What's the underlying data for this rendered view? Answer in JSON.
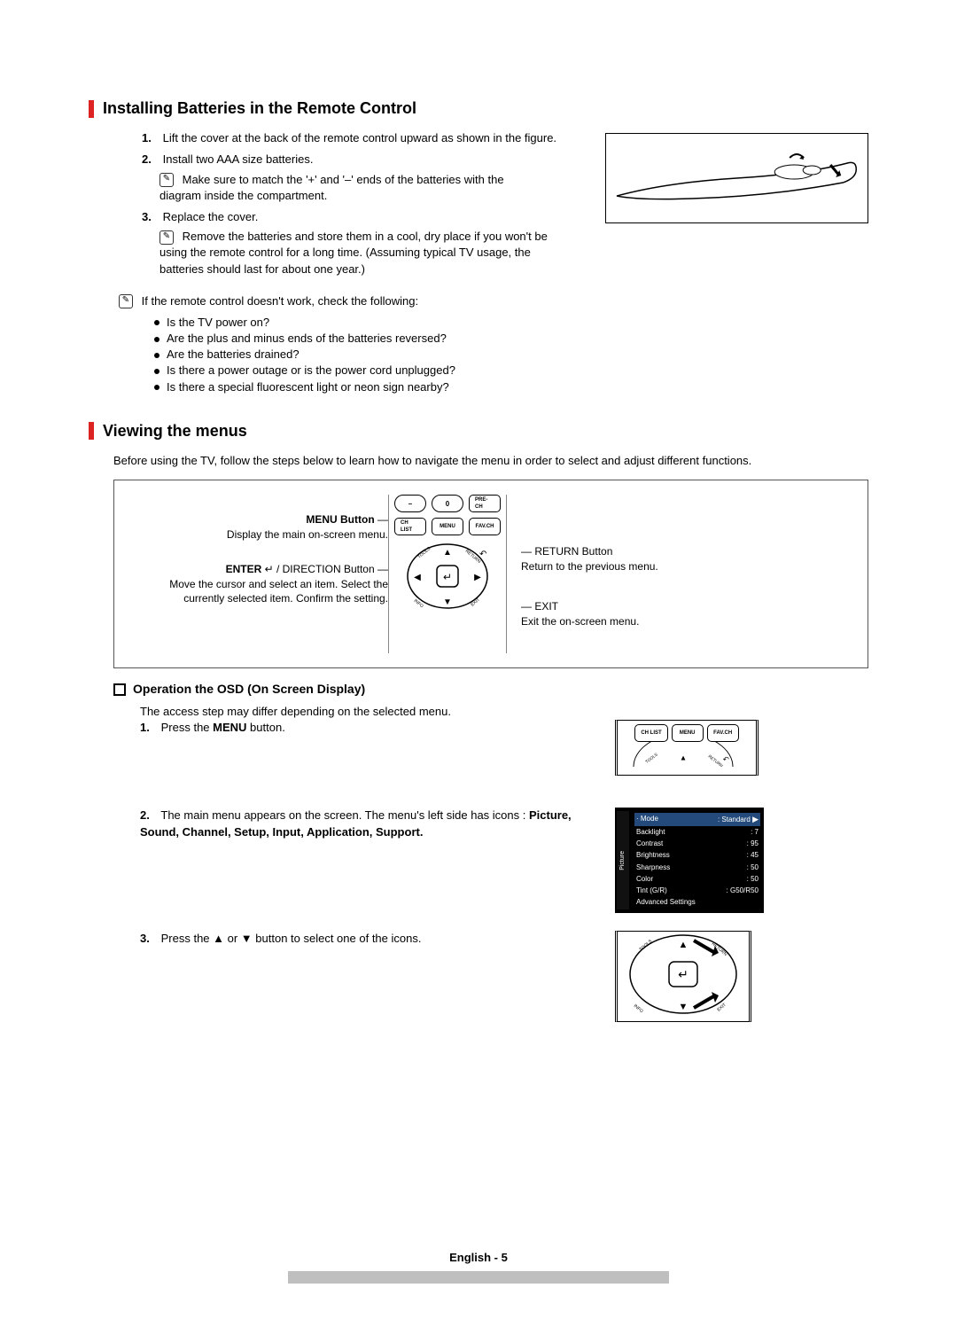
{
  "sections": {
    "batteries": {
      "title": "Installing Batteries in the Remote Control",
      "steps": [
        {
          "n": "1.",
          "text": "Lift the cover at the back of the remote control upward as shown in the figure."
        },
        {
          "n": "2.",
          "text": "Install two AAA size batteries.",
          "note": "Make sure to match the '+' and '–' ends of the batteries with the diagram inside the compartment."
        },
        {
          "n": "3.",
          "text": "Replace the cover.",
          "note": "Remove the batteries and store them in a cool, dry place if you won't be using the remote control for a long time. (Assuming typical TV usage, the batteries should last for about one year.)"
        }
      ],
      "check_intro": "If the remote control doesn't work, check the following:",
      "checks": [
        "Is the TV power on?",
        "Are the plus and minus ends of the batteries reversed?",
        "Are the batteries drained?",
        "Is there a power outage or is the power cord unplugged?",
        "Is there a special fluorescent light or neon sign nearby?"
      ]
    },
    "menus": {
      "title": "Viewing the menus",
      "intro": "Before using the TV, follow the steps below to learn how to navigate the menu in order to select and adjust different functions.",
      "box": {
        "menu_btn_t": "MENU Button",
        "menu_btn_d": "Display the main on-screen menu.",
        "enter_btn_t": "ENTER",
        "enter_btn_suffix": " / DIRECTION Button",
        "enter_btn_d": "Move the cursor and select an item. Select the currently selected item. Confirm the setting.",
        "return_t": "RETURN Button",
        "return_d": "Return to the previous menu.",
        "exit_t": "EXIT",
        "exit_d": "Exit the on-screen menu.",
        "keys": {
          "minus": "–",
          "zero": "0",
          "pre": "PRE-CH",
          "chlist": "CH LIST",
          "menu": "MENU",
          "fav": "FAV.CH",
          "tools": "TOOLS",
          "return": "RETURN",
          "info": "INFO",
          "exit": "EXIT",
          "enter": "↵"
        }
      },
      "osd_title": "Operation the OSD (On Screen Display)",
      "osd_intro": "The access step may differ depending on the selected menu.",
      "osd_steps": [
        {
          "n": "1.",
          "pre": "Press the ",
          "bold": "MENU",
          "post": " button."
        },
        {
          "n": "2.",
          "pre": "The main menu appears on the screen. The menu's left side has icons : ",
          "bold": "Picture, Sound, Channel, Setup, Input, Application, Support."
        },
        {
          "n": "3.",
          "pre": "Press the ▲ or ▼ button to select one of the icons."
        }
      ],
      "osd_menu": {
        "side": "Picture",
        "rows": [
          {
            "l": "Mode",
            "v": ": Standard",
            "hl": true
          },
          {
            "l": "Backlight",
            "v": ": 7"
          },
          {
            "l": "Contrast",
            "v": ": 95"
          },
          {
            "l": "Brightness",
            "v": ": 45"
          },
          {
            "l": "Sharpness",
            "v": ": 50"
          },
          {
            "l": "Color",
            "v": ": 50"
          },
          {
            "l": "Tint (G/R)",
            "v": ": G50/R50"
          },
          {
            "l": "Advanced Settings",
            "v": ""
          }
        ]
      }
    }
  },
  "footer": "English - 5"
}
